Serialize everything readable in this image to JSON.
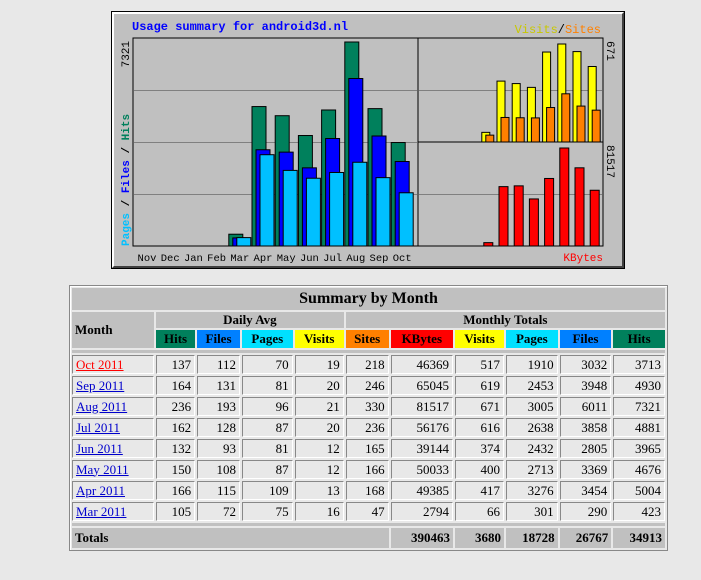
{
  "graph": {
    "title": "Usage summary for android3d.nl",
    "legend_visits": "Visits",
    "legend_sep": "/",
    "legend_sites": "Sites",
    "left_max": "7321",
    "right_top_max": "671",
    "right_bottom_max": "81517",
    "left_legend_pages": "Pages",
    "left_legend_files": "Files",
    "left_legend_hits": "Hits",
    "kbytes_label": "KBytes",
    "colors": {
      "hits": "#00805c",
      "files": "#0000ff",
      "pages": "#00c0ff",
      "visits": "#ffff00",
      "sites": "#ff8000",
      "kbytes": "#ff0000",
      "hits_text": "#00805c",
      "files_text": "#0000ff",
      "pages_text": "#00c0ff",
      "title_text": "#0000ff",
      "visits_text": "#c8c800",
      "sites_text": "#ff8000",
      "kbytes_text": "#ff0000"
    }
  },
  "chart_data": {
    "type": "bar",
    "categories": [
      "Nov",
      "Dec",
      "Jan",
      "Feb",
      "Mar",
      "Apr",
      "May",
      "Jun",
      "Jul",
      "Aug",
      "Sep",
      "Oct"
    ],
    "series": [
      {
        "name": "Hits",
        "values": [
          0,
          0,
          0,
          0,
          423,
          5004,
          4676,
          3965,
          4881,
          7321,
          4930,
          3713
        ]
      },
      {
        "name": "Files",
        "values": [
          0,
          0,
          0,
          0,
          290,
          3454,
          3369,
          2805,
          3858,
          6011,
          3948,
          3032
        ]
      },
      {
        "name": "Pages",
        "values": [
          0,
          0,
          0,
          0,
          301,
          3276,
          2713,
          2432,
          2638,
          3005,
          2453,
          1910
        ]
      },
      {
        "name": "Visits",
        "values": [
          0,
          0,
          0,
          0,
          66,
          417,
          400,
          374,
          616,
          671,
          619,
          517
        ]
      },
      {
        "name": "Sites",
        "values": [
          0,
          0,
          0,
          0,
          47,
          168,
          166,
          165,
          236,
          330,
          246,
          218
        ]
      },
      {
        "name": "KBytes",
        "values": [
          0,
          0,
          0,
          0,
          2794,
          49385,
          50033,
          39144,
          56176,
          81517,
          65045,
          46369
        ]
      }
    ]
  },
  "table": {
    "title": "Summary by Month",
    "month_header": "Month",
    "daily_avg_header": "Daily Avg",
    "monthly_totals_header": "Monthly Totals",
    "daily_cols": [
      "Hits",
      "Files",
      "Pages",
      "Visits"
    ],
    "monthly_cols": [
      "Sites",
      "KBytes",
      "Visits",
      "Pages",
      "Files",
      "Hits"
    ],
    "rows": [
      {
        "month": "Oct 2011",
        "d": [
          "137",
          "112",
          "70",
          "19"
        ],
        "m": [
          "218",
          "46369",
          "517",
          "1910",
          "3032",
          "3713"
        ]
      },
      {
        "month": "Sep 2011",
        "d": [
          "164",
          "131",
          "81",
          "20"
        ],
        "m": [
          "246",
          "65045",
          "619",
          "2453",
          "3948",
          "4930"
        ]
      },
      {
        "month": "Aug 2011",
        "d": [
          "236",
          "193",
          "96",
          "21"
        ],
        "m": [
          "330",
          "81517",
          "671",
          "3005",
          "6011",
          "7321"
        ]
      },
      {
        "month": "Jul 2011",
        "d": [
          "162",
          "128",
          "87",
          "20"
        ],
        "m": [
          "236",
          "56176",
          "616",
          "2638",
          "3858",
          "4881"
        ]
      },
      {
        "month": "Jun 2011",
        "d": [
          "132",
          "93",
          "81",
          "12"
        ],
        "m": [
          "165",
          "39144",
          "374",
          "2432",
          "2805",
          "3965"
        ]
      },
      {
        "month": "May 2011",
        "d": [
          "150",
          "108",
          "87",
          "12"
        ],
        "m": [
          "166",
          "50033",
          "400",
          "2713",
          "3369",
          "4676"
        ]
      },
      {
        "month": "Apr 2011",
        "d": [
          "166",
          "115",
          "109",
          "13"
        ],
        "m": [
          "168",
          "49385",
          "417",
          "3276",
          "3454",
          "5004"
        ]
      },
      {
        "month": "Mar 2011",
        "d": [
          "105",
          "72",
          "75",
          "16"
        ],
        "m": [
          "47",
          "2794",
          "66",
          "301",
          "290",
          "423"
        ]
      }
    ],
    "totals_label": "Totals",
    "totals": [
      "390463",
      "3680",
      "18728",
      "26767",
      "34913"
    ]
  }
}
